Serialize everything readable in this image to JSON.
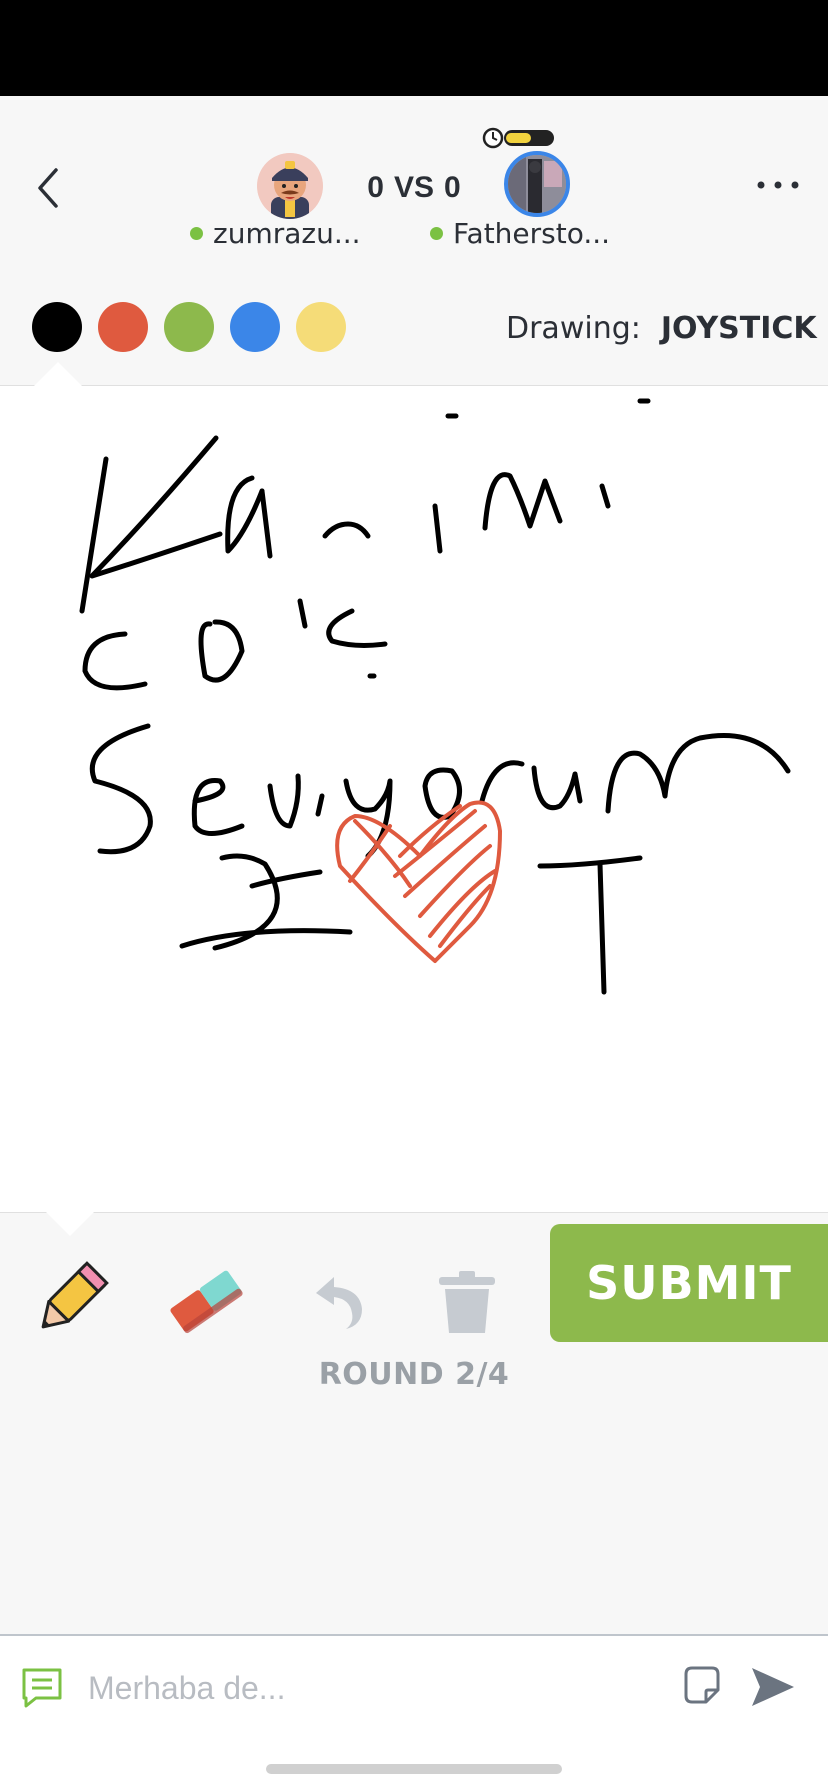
{
  "colors": {
    "palette": [
      "#000000",
      "#df5a3f",
      "#8db94c",
      "#3b86e8",
      "#f5dc78"
    ],
    "accent_submit": "#8db94c",
    "online": "#7bc143",
    "stroke_black": "#000000",
    "stroke_red": "#df5a3f"
  },
  "header": {
    "back_icon": "chevron-left-icon",
    "more_icon": "ellipsis-icon",
    "timer": {
      "icon": "clock-icon",
      "remaining_fraction": 0.55
    },
    "score": {
      "left": "0",
      "vs": "VS",
      "right": "0"
    },
    "players": [
      {
        "name": "zumrazu...",
        "status": "online"
      },
      {
        "name": "Fathersto...",
        "status": "online"
      }
    ]
  },
  "drawing": {
    "label": "Drawing:",
    "word": "JOYSTICK"
  },
  "toolbar": {
    "tools": [
      "pencil-icon",
      "eraser-icon",
      "undo-icon",
      "trash-icon"
    ],
    "submit_label": "SUBMIT",
    "round_label": "ROUND 2/4"
  },
  "chat": {
    "placeholder": "Merhaba de...",
    "chat_icon": "chat-bubble-icon",
    "sticker_icon": "sticker-icon",
    "send_icon": "send-icon"
  }
}
